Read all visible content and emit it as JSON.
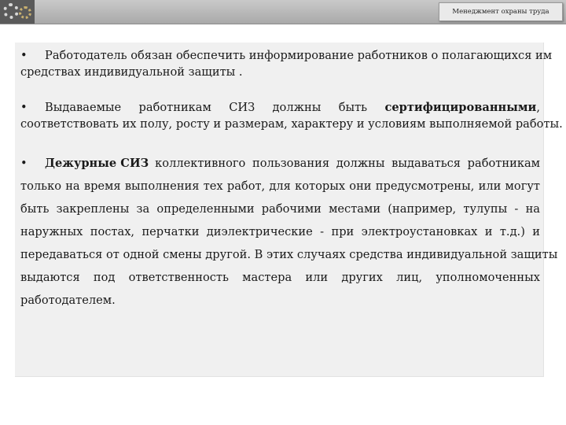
{
  "header": {
    "badge_text": "Менеджмент охраны труда",
    "logo_icon": "gear-logo-icon"
  },
  "content": {
    "p1": {
      "bullet": "•",
      "line1": "Работодатель обязан обеспечить информирование работников о полагающихся им",
      "line2": "средствах индивидуальной защиты ."
    },
    "p2": {
      "bullet": "•",
      "w1": "Выдаваемые",
      "w2": "работникам",
      "w3": "СИЗ",
      "w4": "должны",
      "w5": "быть",
      "w6_bold": "сертифицированными",
      "w7": ",",
      "line2": "соответствовать их полу, росту и размерам, характеру и условиям выполняемой работы."
    },
    "p3": {
      "bullet": "•",
      "lead_bold": "Дежурные СИЗ",
      "lines": [
        "коллективного пользования должны выдаваться работникам",
        "только на время выполнения тех работ, для которых они предусмотрены, или могут",
        "быть закреплены за определенными рабочими местами (например, тулупы - на",
        "наружных постах, перчатки диэлектрические - при электроустановках и т.д.) и",
        "передаваться от одной смены другой. В этих случаях средства индивидуальной защиты"
      ],
      "line7_words": [
        "выдаются",
        "под",
        "ответственность",
        "мастера",
        "или",
        "других",
        "лиц,",
        "уполномоченных"
      ],
      "last_line": "работодателем."
    }
  },
  "colors": {
    "header_gray": "#b5b5b5",
    "panel_bg": "#f0f0f0",
    "text": "#1a1a1a"
  }
}
